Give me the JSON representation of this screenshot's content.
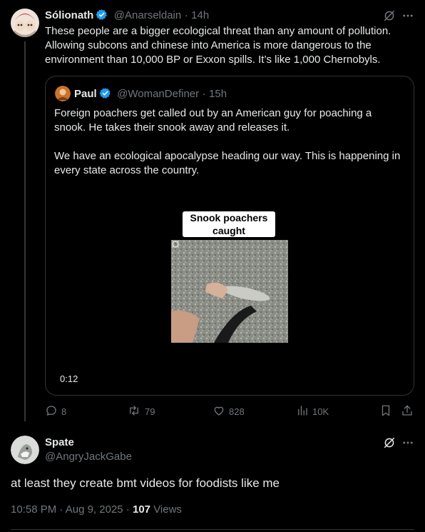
{
  "tweet": {
    "author_name": "Sólionath",
    "handle": "@Anarseldain",
    "separator": "·",
    "time": "14h",
    "text": "These people are a bigger ecological threat than any amount of pollution. Allowing subcons and chinese into America is more dangerous to the environment than 10,000 BP or Exxon spills. It’s like 1,000 Chernobyls."
  },
  "quote": {
    "author_name": "Paul",
    "handle": "@WomanDefiner",
    "separator": "·",
    "time": "15h",
    "text": "Foreign poachers get called out by an American guy for poaching a snook. He takes their snook away and releases it.\n\nWe have an ecological apocalypse heading our way. This is happening in every state across the country.",
    "video_caption": "Snook poachers caught",
    "video_duration": "0:12"
  },
  "actions": {
    "replies": "8",
    "reposts": "79",
    "likes": "828",
    "views": "10K"
  },
  "reply": {
    "author_name": "Spate",
    "handle": "@AngryJackGabe",
    "text": "at least they create bmt videos for foodists like me",
    "time": "10:58 PM",
    "separator": "·",
    "date": "Aug 9, 2025",
    "views_count": "107",
    "views_label": "Views"
  },
  "colors": {
    "background": "#000000",
    "text": "#e7e9ea",
    "muted": "#71767b",
    "verified": "#1d9bf0",
    "border": "#2f3336"
  }
}
